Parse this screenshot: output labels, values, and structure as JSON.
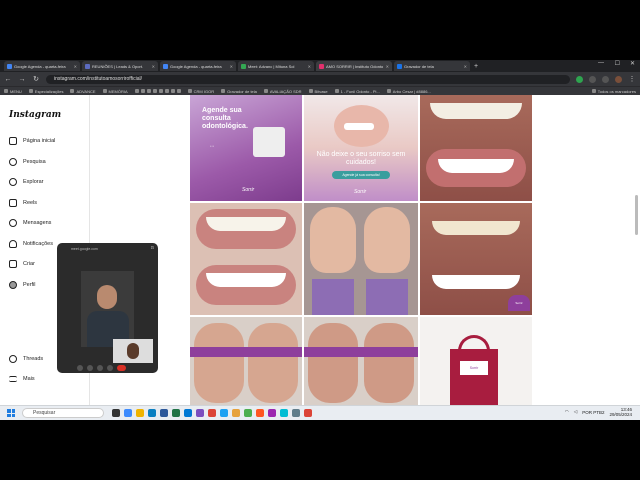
{
  "tabs": [
    {
      "title": "Google Agenda - quarta-feira",
      "color": "#4285f4"
    },
    {
      "title": "REUNIÕES | Leads & Oport.",
      "color": "#5c6bc0"
    },
    {
      "title": "Google Agenda - quarta-feira",
      "color": "#4285f4"
    },
    {
      "title": "Meet: Advanc | Mituna Sol",
      "color": "#34a853"
    },
    {
      "title": "AMO SORRIR | Instituto Odonto",
      "color": "#e1306c"
    },
    {
      "title": "Gravador de tela",
      "color": "#1a73e8"
    }
  ],
  "url": "instagram.com/institutoamosorrirofficial/",
  "bookmarks": [
    "MENU",
    "Especializações",
    "ADVANCE",
    "MEMÓRIA",
    "CRM IGOR",
    "Gravador de tela",
    "AVALIAÇÃO SDR",
    "Bitvase",
    "1 - Funil Odonto - Pi...",
    "Arbo Cesar | #8886...",
    "Todos os marcadores"
  ],
  "instagram": {
    "logo": "Instagram",
    "nav": [
      {
        "label": "Página inicial",
        "icon": "home-icon"
      },
      {
        "label": "Pesquisa",
        "icon": "search-icon"
      },
      {
        "label": "Explorar",
        "icon": "compass-icon"
      },
      {
        "label": "Reels",
        "icon": "reels-icon"
      },
      {
        "label": "Mensagens",
        "icon": "messenger-icon"
      },
      {
        "label": "Notificações",
        "icon": "heart-icon"
      },
      {
        "label": "Criar",
        "icon": "plus-icon"
      },
      {
        "label": "Perfil",
        "icon": "profile-icon"
      }
    ],
    "bottom_nav": [
      {
        "label": "Threads",
        "icon": "threads-icon"
      },
      {
        "label": "Mais",
        "icon": "menu-icon"
      }
    ]
  },
  "posts": {
    "p1_title": "Agende sua consulta odontológica.",
    "p1_brand": "Sorrir",
    "p2_title": "Não deixe o seu sorriso sem cuidados!",
    "p2_cta": "Agende já sua consulta!",
    "p2_brand": "Sorrir",
    "p6_brand": "Sorrir",
    "p9_bag": "Sorrir"
  },
  "video": {
    "url": "meet.google.com"
  },
  "taskbar": {
    "search": "Pesquisar",
    "lang": "POR PTB2",
    "time": "13:46",
    "date": "29/05/2024"
  },
  "colors": {
    "brand_purple": "#8e3f9c",
    "meet_end": "#d93025"
  }
}
